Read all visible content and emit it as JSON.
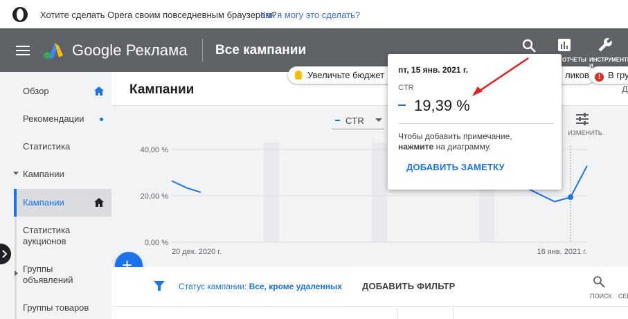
{
  "opera": {
    "prompt": "Хотите сделать Opera своим повседневным браузером?",
    "link": "Как я могу это сделать?"
  },
  "header": {
    "brand": "Google Реклама",
    "title": "Все кампании",
    "reports_label": "ОТЧЕТЫ",
    "tools_label": "ИНСТРУМЕНТЫ И"
  },
  "notifications": {
    "budget": "Увеличьте бюджет",
    "clicks": "ликов",
    "groups": "В гру"
  },
  "sidebar": {
    "items": [
      {
        "label": "Обзор"
      },
      {
        "label": "Рекомендации"
      },
      {
        "label": "Статистика"
      },
      {
        "label": "Кампании"
      },
      {
        "label": "Кампании"
      },
      {
        "label": "Статистика аукционов"
      },
      {
        "label": "Группы объявлений"
      },
      {
        "label": "Группы товаров"
      }
    ]
  },
  "main": {
    "title": "Кампании",
    "metric_select": "CTR",
    "adjust_label": "ИЗМЕНИТЬ",
    "right_cut": "Д"
  },
  "chart_data": {
    "type": "line",
    "ylim": [
      0,
      40
    ],
    "y_ticks": [
      "40,00 %",
      "20,00 %",
      "0,00 %"
    ],
    "x_tick_labels": [
      "20 дек. 2020 г.",
      "16 янв. 2021 г."
    ],
    "series": [
      {
        "values_segment_start": [
          26.5,
          23.5,
          21.5
        ],
        "values_segment_end": [
          27.0,
          23.0,
          17.5,
          19.39,
          33.0
        ]
      }
    ],
    "color": "#1a73e8"
  },
  "tooltip": {
    "date": "пт, 15 янв. 2021 г.",
    "metric": "CTR",
    "value": "19,39 %",
    "note_1": "Чтобы добавить примечание,",
    "note_bold": "нажмите",
    "note_2": "на диаграмму.",
    "add_note": "ДОБАВИТЬ ЗАМЕТКУ"
  },
  "filter": {
    "status_prefix": "Статус кампании:",
    "status_value": "Все, кроме удаленных",
    "add_filter": "ДОБАВИТЬ ФИЛЬТР",
    "search_label": "ПОИСК",
    "segment_label": "СЕГ"
  },
  "colors": {
    "header_bg": "#5f6368",
    "accent": "#1a73e8",
    "annotation_arrow": "#e02020"
  }
}
